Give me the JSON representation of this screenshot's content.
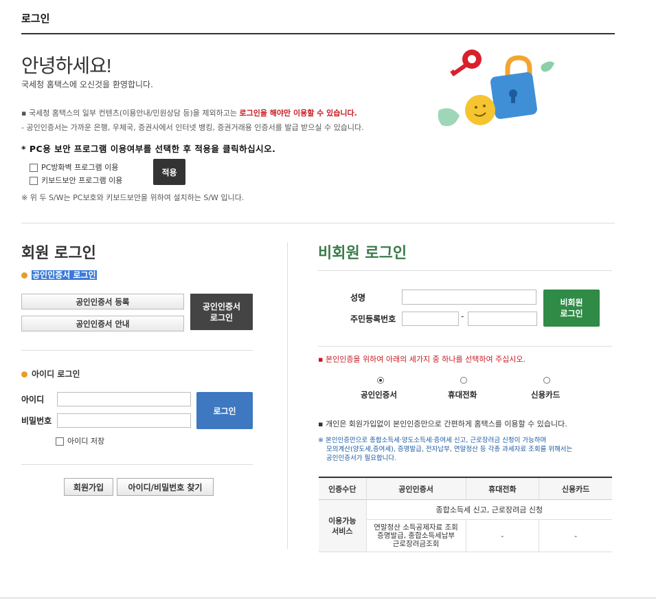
{
  "page": {
    "title": "로그인"
  },
  "intro": {
    "hello": "안녕하세요!",
    "welcome": "국세청 홈택스에 오신것을 환영합니다.",
    "note1_pre": "국세청 홈택스의 일부 컨텐츠(이용안내/민원상담 등)을 제외하고는 ",
    "note1_red": "로그인을 해야만 이용할 수 있습니다.",
    "note2": "공인인증서는 가까운 은행, 우체국, 증권사에서 인터넷 뱅킹, 증권거래용 인증서를 발급 받으실 수 있습니다."
  },
  "security": {
    "title": "* PC용 보안 프로그램 이용여부를 선택한 후 적용을 클릭하십시오.",
    "option1": "PC방화벽 프로그램 이용",
    "option2": "키보드보안 프로그램 이용",
    "apply": "적용",
    "footnote": "※ 위 두 S/W는 PC보호와 키보드보안을 위하여 설치하는 S/W 입니다."
  },
  "member": {
    "title": "회원 로그인",
    "cert_section": "공인인증서 로그인",
    "cert_register": "공인인증서 등록",
    "cert_guide": "공인인증서 안내",
    "cert_login_line1": "공인인증서",
    "cert_login_line2": "로그인",
    "id_section": "아이디 로그인",
    "id_label": "아이디",
    "pw_label": "비밀번호",
    "login": "로그인",
    "save_id": "아이디 저장",
    "join": "회원가입",
    "find": "아이디/비밀번호 찾기"
  },
  "nonmember": {
    "title": "비회원 로그인",
    "name_label": "성명",
    "rrn_label": "주민등록번호",
    "rrn_dash": "-",
    "login_line1": "비회원",
    "login_line2": "로그인",
    "select_note": "본인인증을 위하여 아래의 세가지 중 하나를 선택하여 주십시오.",
    "options": [
      "공인인증서",
      "휴대전화",
      "신용카드"
    ],
    "selected": "공인인증서",
    "simple_note": "개인은 회원가입없이 본인인증만으로 간편하게 홈택스를 이용할 수 있습니다.",
    "warn_line1": "※ 본인인증만으로 종합소득세·양도소득세·증여세 신고, 근로장려금 신청이 가능하며",
    "warn_line2": "모의계산(양도세,증여세), 증명발급, 전자납부, 연말정산 등 각종 과세자료 조회를 위해서는",
    "warn_line3": "공인인증서가 필요합니다."
  },
  "table": {
    "headers": [
      "인증수단",
      "공인인증서",
      "휴대전화",
      "신용카드"
    ],
    "row_label_1": "이용가능",
    "row_label_2": "서비스",
    "merged_cell": "종합소득세 신고, 근로장려금 신청",
    "cert_cell_1": "연말정산 소득공제자료 조회",
    "cert_cell_2": "증명발급, 종합소득세납부",
    "cert_cell_3": "근로장려금조회",
    "phone_cell": "-",
    "card_cell": "-"
  },
  "colors": {
    "accent_red": "#c8181e",
    "member_blue": "#3d78c1",
    "nonmember_green": "#2f8b46",
    "title_green": "#3a7a4a"
  }
}
